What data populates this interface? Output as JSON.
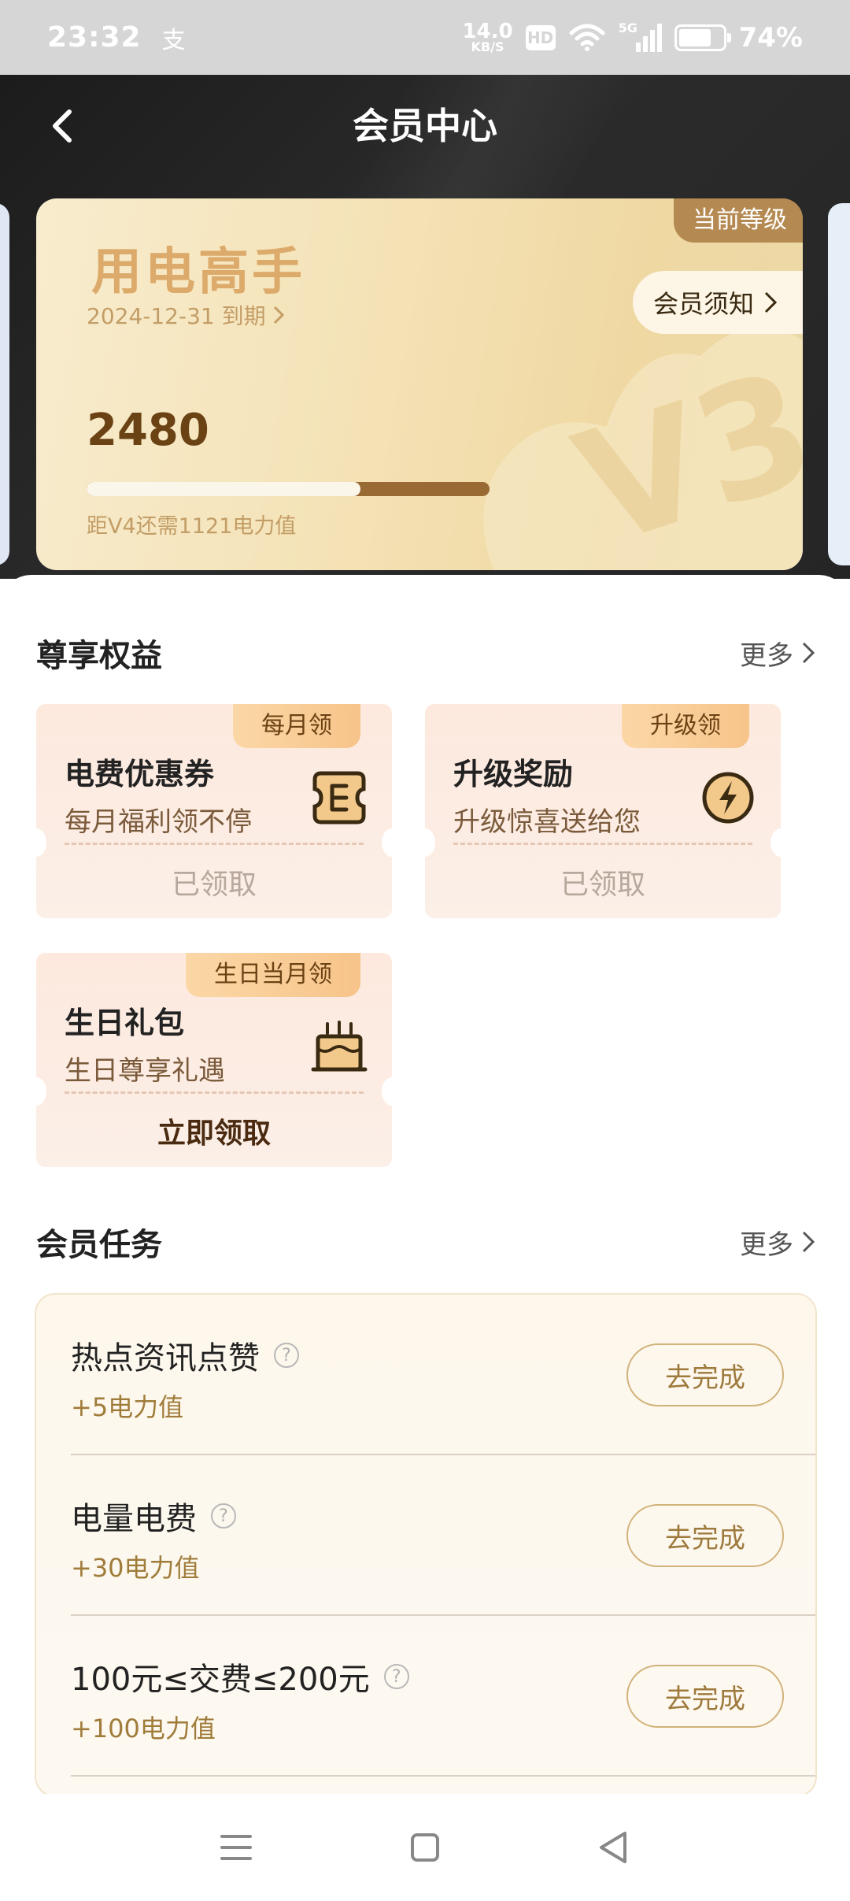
{
  "status_bar": {
    "time": "23:32",
    "app_glyph": "支",
    "net_speed_value": "14.0",
    "net_speed_unit": "KB/S",
    "hd": "HD",
    "network": "5G",
    "battery_pct": "74%",
    "battery_level": 0.74
  },
  "header": {
    "title": "会员中心"
  },
  "level_card": {
    "level_name": "用电高手",
    "expire_text": "2024-12-31 到期",
    "current_badge": "当前等级",
    "notice_button": "会员须知",
    "points": "2480",
    "progress_fraction": 0.68,
    "progress_hint": "距V4还需1121电力值",
    "watermark_text": "V3"
  },
  "benefits": {
    "title": "尊享权益",
    "more": "更多",
    "items": [
      {
        "tag": "每月领",
        "title": "电费优惠券",
        "desc": "每月福利领不停",
        "action": "已领取",
        "icon": "coupon-icon"
      },
      {
        "tag": "升级领",
        "title": "升级奖励",
        "desc": "升级惊喜送给您",
        "action": "已领取",
        "icon": "lightning-icon"
      },
      {
        "tag": "生日当月领",
        "title": "生日礼包",
        "desc": "生日尊享礼遇",
        "action": "立即领取",
        "icon": "cake-icon"
      }
    ]
  },
  "tasks": {
    "title": "会员任务",
    "more": "更多",
    "items": [
      {
        "name": "热点资讯点赞",
        "reward": "+5电力值",
        "button": "去完成"
      },
      {
        "name": "电量电费",
        "reward": "+30电力值",
        "button": "去完成"
      },
      {
        "name": "100元≤交费≤200元",
        "reward": "+100电力值",
        "button": "去完成"
      }
    ]
  },
  "colors": {
    "accent_gold": "#b58a52",
    "dark_header": "#222222"
  }
}
